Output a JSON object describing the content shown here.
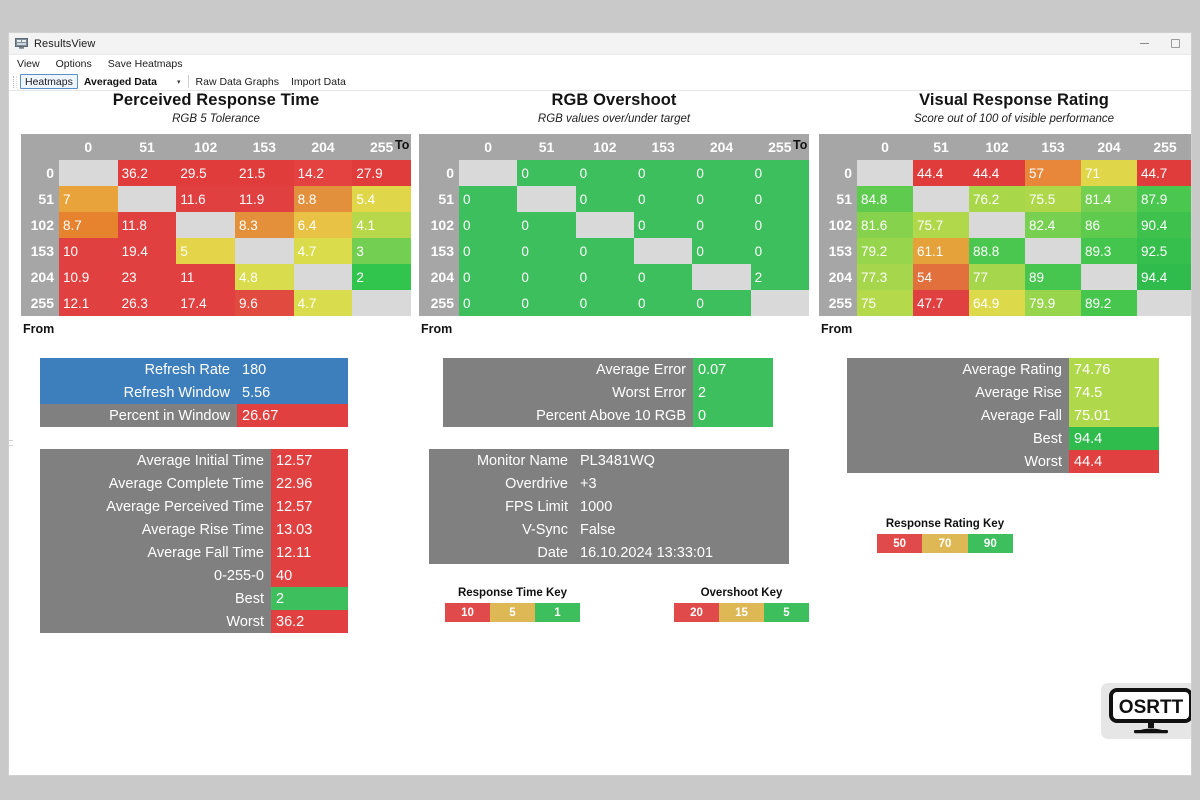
{
  "window": {
    "title": "ResultsView",
    "icon": "monitor-icon",
    "minimize": "minimize-icon",
    "maximize": "maximize-icon"
  },
  "menu": {
    "items": [
      "View",
      "Options",
      "Save Heatmaps"
    ]
  },
  "toolbar": {
    "heatmaps_button": "Heatmaps",
    "dataset_select": "Averaged Data",
    "dataset_arrow": "▾",
    "raw_data_link": "Raw Data Graphs",
    "import_link": "Import Data"
  },
  "axis": {
    "to": "To",
    "from": "From"
  },
  "heatmaps": [
    {
      "title": "Perceived Response Time",
      "subtitle": "RGB 5 Tolerance",
      "columns": [
        "0",
        "51",
        "102",
        "153",
        "204",
        "255"
      ],
      "rows": [
        "0",
        "51",
        "102",
        "153",
        "204",
        "255"
      ],
      "cells": [
        [
          null,
          "36.2",
          "29.5",
          "21.5",
          "14.2",
          "27.9"
        ],
        [
          "7",
          null,
          "11.6",
          "11.9",
          "8.8",
          "5.4"
        ],
        [
          "8.7",
          "11.8",
          null,
          "8.3",
          "6.4",
          "4.1"
        ],
        [
          "10",
          "19.4",
          "5",
          null,
          "4.7",
          "3"
        ],
        [
          "10.9",
          "23",
          "11",
          "4.8",
          null,
          "2"
        ],
        [
          "12.1",
          "26.3",
          "17.4",
          "9.6",
          "4.7",
          null
        ]
      ],
      "colors": [
        [
          null,
          "#e03c3c",
          "#e03c3c",
          "#e03c3c",
          "#e44141",
          "#e03c3c"
        ],
        [
          "#e8a33a",
          null,
          "#e14040",
          "#e14040",
          "#e2903b",
          "#e0d64a"
        ],
        [
          "#e7832f",
          "#e14040",
          null,
          "#e4903a",
          "#e8c245",
          "#b7d84a"
        ],
        [
          "#e14040",
          "#e14040",
          "#e3d44a",
          null,
          "#dbdc4c",
          "#72cf52"
        ],
        [
          "#e14040",
          "#e14040",
          "#e14040",
          "#d9dc4c",
          null,
          "#31c54e"
        ],
        [
          "#e14040",
          "#e14040",
          "#e14040",
          "#e14b3f",
          "#d9dc4c",
          null
        ]
      ]
    },
    {
      "title": "RGB Overshoot",
      "subtitle": "RGB values over/under target",
      "columns": [
        "0",
        "51",
        "102",
        "153",
        "204",
        "255"
      ],
      "rows": [
        "0",
        "51",
        "102",
        "153",
        "204",
        "255"
      ],
      "cells": [
        [
          null,
          "0",
          "0",
          "0",
          "0",
          "0"
        ],
        [
          "0",
          null,
          "0",
          "0",
          "0",
          "0"
        ],
        [
          "0",
          "0",
          null,
          "0",
          "0",
          "0"
        ],
        [
          "0",
          "0",
          "0",
          null,
          "0",
          "0"
        ],
        [
          "0",
          "0",
          "0",
          "0",
          null,
          "2"
        ],
        [
          "0",
          "0",
          "0",
          "0",
          "0",
          null
        ]
      ],
      "colors": [
        [
          null,
          "#3cbf5c",
          "#3cbf5c",
          "#3cbf5c",
          "#3cbf5c",
          "#3cbf5c"
        ],
        [
          "#3cbf5c",
          null,
          "#3cbf5c",
          "#3cbf5c",
          "#3cbf5c",
          "#3cbf5c"
        ],
        [
          "#3cbf5c",
          "#3cbf5c",
          null,
          "#3cbf5c",
          "#3cbf5c",
          "#3cbf5c"
        ],
        [
          "#3cbf5c",
          "#3cbf5c",
          "#3cbf5c",
          null,
          "#3cbf5c",
          "#3cbf5c"
        ],
        [
          "#3cbf5c",
          "#3cbf5c",
          "#3cbf5c",
          "#3cbf5c",
          null,
          "#3cbf5c"
        ],
        [
          "#3cbf5c",
          "#3cbf5c",
          "#3cbf5c",
          "#3cbf5c",
          "#3cbf5c",
          null
        ]
      ]
    },
    {
      "title": "Visual Response Rating",
      "subtitle": "Score out of 100 of visible performance",
      "columns": [
        "0",
        "51",
        "102",
        "153",
        "204",
        "255"
      ],
      "rows": [
        "0",
        "51",
        "102",
        "153",
        "204",
        "255"
      ],
      "cells": [
        [
          null,
          "44.4",
          "44.4",
          "57",
          "71",
          "44.7"
        ],
        [
          "84.8",
          null,
          "76.2",
          "75.5",
          "81.4",
          "87.9"
        ],
        [
          "81.6",
          "75.7",
          null,
          "82.4",
          "86",
          "90.4"
        ],
        [
          "79.2",
          "61.1",
          "88.8",
          null,
          "89.3",
          "92.5"
        ],
        [
          "77.3",
          "54",
          "77",
          "89",
          null,
          "94.4"
        ],
        [
          "75",
          "47.7",
          "64.9",
          "79.9",
          "89.2",
          null
        ]
      ],
      "colors": [
        [
          null,
          "#e03c3c",
          "#e03c3c",
          "#e8863a",
          "#e0d64a",
          "#e03c3c"
        ],
        [
          "#5ecb4f",
          null,
          "#a9d74a",
          "#aed84a",
          "#74cf51",
          "#49c74e"
        ],
        [
          "#86d24d",
          "#b1d84b",
          null,
          "#78d051",
          "#5ecb4f",
          "#3ec24d"
        ],
        [
          "#97d54c",
          "#e5a13a",
          "#4ac74e",
          null,
          "#44c54d",
          "#36bf4d"
        ],
        [
          "#a6d64b",
          "#e2703c",
          "#a6d64b",
          "#46c64e",
          null,
          "#2fbc4c"
        ],
        [
          "#b4d94a",
          "#e14040",
          "#dcd94b",
          "#96d54c",
          "#47c64e",
          null
        ]
      ]
    }
  ],
  "panels": {
    "refresh": {
      "rows": [
        {
          "label": "Refresh Rate",
          "value": "180",
          "label_bg": "#3d7ebc",
          "value_bg": "#3d7ebc"
        },
        {
          "label": "Refresh Window",
          "value": "5.56",
          "label_bg": "#3d7ebc",
          "value_bg": "#3d7ebc"
        },
        {
          "label": "Percent in Window",
          "value": "26.67",
          "label_bg": "#808080",
          "value_bg": "#e14040"
        }
      ]
    },
    "times": {
      "rows": [
        {
          "label": "Average Initial Time",
          "value": "12.57",
          "label_bg": "#808080",
          "value_bg": "#e14040"
        },
        {
          "label": "Average Complete Time",
          "value": "22.96",
          "label_bg": "#808080",
          "value_bg": "#e14040"
        },
        {
          "label": "Average Perceived Time",
          "value": "12.57",
          "label_bg": "#808080",
          "value_bg": "#e14040"
        },
        {
          "label": "Average Rise Time",
          "value": "13.03",
          "label_bg": "#808080",
          "value_bg": "#e14040"
        },
        {
          "label": "Average Fall Time",
          "value": "12.11",
          "label_bg": "#808080",
          "value_bg": "#e14040"
        },
        {
          "label": "0-255-0",
          "value": "40",
          "label_bg": "#808080",
          "value_bg": "#e14040"
        },
        {
          "label": "Best",
          "value": "2",
          "label_bg": "#808080",
          "value_bg": "#3cbf5c"
        },
        {
          "label": "Worst",
          "value": "36.2",
          "label_bg": "#808080",
          "value_bg": "#e14040"
        }
      ]
    },
    "error": {
      "rows": [
        {
          "label": "Average Error",
          "value": "0.07",
          "label_bg": "#808080",
          "value_bg": "#3cbf5c"
        },
        {
          "label": "Worst Error",
          "value": "2",
          "label_bg": "#808080",
          "value_bg": "#3cbf5c"
        },
        {
          "label": "Percent Above 10 RGB",
          "value": "0",
          "label_bg": "#808080",
          "value_bg": "#3cbf5c"
        }
      ]
    },
    "monitor": {
      "rows": [
        {
          "label": "Monitor Name",
          "value": "PL3481WQ",
          "label_bg": "#808080",
          "value_bg": "#808080"
        },
        {
          "label": "Overdrive",
          "value": "+3",
          "label_bg": "#808080",
          "value_bg": "#808080"
        },
        {
          "label": "FPS Limit",
          "value": "1000",
          "label_bg": "#808080",
          "value_bg": "#808080"
        },
        {
          "label": "V-Sync",
          "value": "False",
          "label_bg": "#808080",
          "value_bg": "#808080"
        },
        {
          "label": "Date",
          "value": "16.10.2024 13:33:01",
          "label_bg": "#808080",
          "value_bg": "#808080"
        }
      ]
    },
    "rating": {
      "rows": [
        {
          "label": "Average Rating",
          "value": "74.76",
          "label_bg": "#808080",
          "value_bg": "#b0d84b"
        },
        {
          "label": "Average Rise",
          "value": "74.5",
          "label_bg": "#808080",
          "value_bg": "#b0d84b"
        },
        {
          "label": "Average Fall",
          "value": "75.01",
          "label_bg": "#808080",
          "value_bg": "#b0d84b"
        },
        {
          "label": "Best",
          "value": "94.4",
          "label_bg": "#808080",
          "value_bg": "#2fbc4c"
        },
        {
          "label": "Worst",
          "value": "44.4",
          "label_bg": "#808080",
          "value_bg": "#e14040"
        }
      ]
    }
  },
  "keys": [
    {
      "title": "Response Time Key",
      "segments": [
        {
          "label": "10",
          "color": "#e04a4a"
        },
        {
          "label": "5",
          "color": "#ddb855"
        },
        {
          "label": "1",
          "color": "#3cbf5c"
        }
      ]
    },
    {
      "title": "Overshoot Key",
      "segments": [
        {
          "label": "20",
          "color": "#e04a4a"
        },
        {
          "label": "15",
          "color": "#ddb855"
        },
        {
          "label": "5",
          "color": "#3cbf5c"
        }
      ]
    },
    {
      "title": "Response Rating Key",
      "segments": [
        {
          "label": "50",
          "color": "#e04a4a"
        },
        {
          "label": "70",
          "color": "#ddb855"
        },
        {
          "label": "90",
          "color": "#3cbf5c"
        }
      ]
    }
  ],
  "logo": {
    "text": "OSRTT"
  },
  "chart_data": [
    {
      "type": "heatmap",
      "title": "Perceived Response Time",
      "subtitle": "RGB 5 Tolerance",
      "xlabel": "To",
      "ylabel": "From",
      "x": [
        "0",
        "51",
        "102",
        "153",
        "204",
        "255"
      ],
      "y": [
        "0",
        "51",
        "102",
        "153",
        "204",
        "255"
      ],
      "values": [
        [
          null,
          36.2,
          29.5,
          21.5,
          14.2,
          27.9
        ],
        [
          7,
          null,
          11.6,
          11.9,
          8.8,
          5.4
        ],
        [
          8.7,
          11.8,
          null,
          8.3,
          6.4,
          4.1
        ],
        [
          10,
          19.4,
          5,
          null,
          4.7,
          3
        ],
        [
          10.9,
          23,
          11,
          4.8,
          null,
          2
        ],
        [
          12.1,
          26.3,
          17.4,
          9.6,
          4.7,
          null
        ]
      ],
      "colorscale": "red(high)-yellow-green(low)",
      "legend": {
        "title": "Response Time Key",
        "stops": [
          10,
          5,
          1
        ]
      }
    },
    {
      "type": "heatmap",
      "title": "RGB Overshoot",
      "subtitle": "RGB values over/under target",
      "xlabel": "To",
      "ylabel": "From",
      "x": [
        "0",
        "51",
        "102",
        "153",
        "204",
        "255"
      ],
      "y": [
        "0",
        "51",
        "102",
        "153",
        "204",
        "255"
      ],
      "values": [
        [
          null,
          0,
          0,
          0,
          0,
          0
        ],
        [
          0,
          null,
          0,
          0,
          0,
          0
        ],
        [
          0,
          0,
          null,
          0,
          0,
          0
        ],
        [
          0,
          0,
          0,
          null,
          0,
          0
        ],
        [
          0,
          0,
          0,
          0,
          null,
          2
        ],
        [
          0,
          0,
          0,
          0,
          0,
          null
        ]
      ],
      "colorscale": "red(high)-yellow-green(low)",
      "legend": {
        "title": "Overshoot Key",
        "stops": [
          20,
          15,
          5
        ]
      }
    },
    {
      "type": "heatmap",
      "title": "Visual Response Rating",
      "subtitle": "Score out of 100 of visible performance",
      "xlabel": "To",
      "ylabel": "From",
      "x": [
        "0",
        "51",
        "102",
        "153",
        "204",
        "255"
      ],
      "y": [
        "0",
        "51",
        "102",
        "153",
        "204",
        "255"
      ],
      "values": [
        [
          null,
          44.4,
          44.4,
          57,
          71,
          44.7
        ],
        [
          84.8,
          null,
          76.2,
          75.5,
          81.4,
          87.9
        ],
        [
          81.6,
          75.7,
          null,
          82.4,
          86,
          90.4
        ],
        [
          79.2,
          61.1,
          88.8,
          null,
          89.3,
          92.5
        ],
        [
          77.3,
          54,
          77,
          89,
          null,
          94.4
        ],
        [
          75,
          47.7,
          64.9,
          79.9,
          89.2,
          null
        ]
      ],
      "colorscale": "red(low)-yellow-green(high)",
      "legend": {
        "title": "Response Rating Key",
        "stops": [
          50,
          70,
          90
        ]
      }
    }
  ]
}
